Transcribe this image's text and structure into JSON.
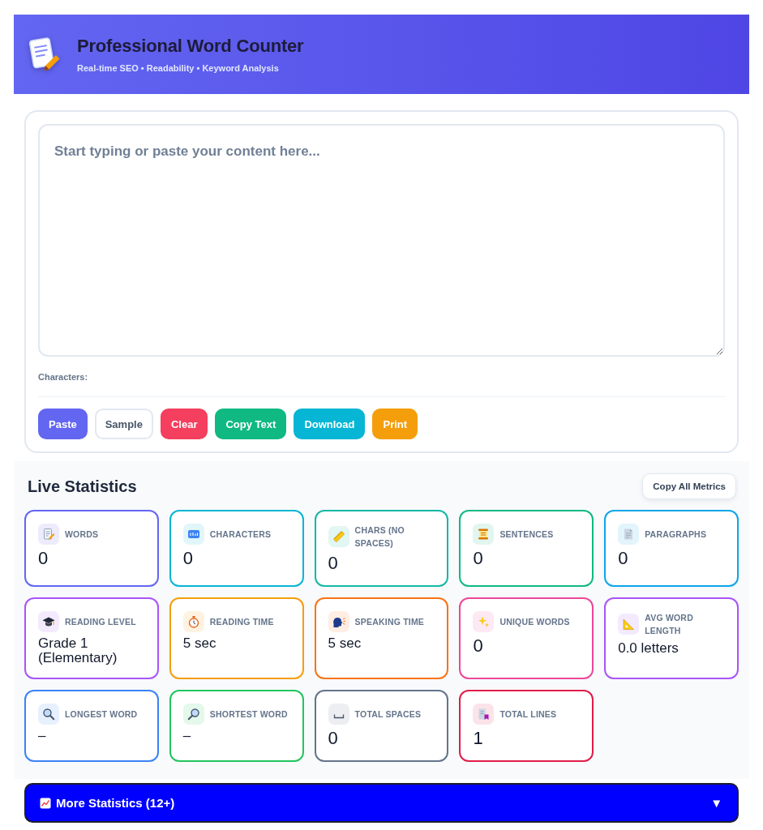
{
  "header": {
    "title": "Professional Word Counter",
    "subtitle": "Real-time SEO • Readability • Keyword Analysis"
  },
  "editor": {
    "placeholder": "Start typing or paste your content here...",
    "characters_label": "Characters:",
    "buttons": [
      {
        "label": "Paste",
        "kind": "filled",
        "color": "#6366f1"
      },
      {
        "label": "Sample",
        "kind": "outline"
      },
      {
        "label": "Clear",
        "kind": "filled",
        "color": "#f43f5e"
      },
      {
        "label": "Copy Text",
        "kind": "filled",
        "color": "#10b981"
      },
      {
        "label": "Download",
        "kind": "filled",
        "color": "#06b6d4"
      },
      {
        "label": "Print",
        "kind": "filled",
        "color": "#f59e0b"
      }
    ]
  },
  "statistics": {
    "title": "Live Statistics",
    "copy_button": "Copy All Metrics",
    "stats": [
      {
        "label": "WORDS",
        "value": "0",
        "kind": "number",
        "color": "#6366f1"
      },
      {
        "label": "CHARACTERS",
        "value": "0",
        "kind": "number",
        "color": "#06b6d4"
      },
      {
        "label": "CHARS (NO SPACES)",
        "value": "0",
        "kind": "number",
        "color": "#14b8a6"
      },
      {
        "label": "SENTENCES",
        "value": "0",
        "kind": "number",
        "color": "#10b981"
      },
      {
        "label": "PARAGRAPHS",
        "value": "0",
        "kind": "number",
        "color": "#0ea5e9"
      },
      {
        "label": "READING LEVEL",
        "value": "Grade 1 (Elementary)",
        "kind": "text",
        "color": "#a855f7"
      },
      {
        "label": "READING TIME",
        "value": "5 sec",
        "kind": "text",
        "color": "#f59e0b"
      },
      {
        "label": "SPEAKING TIME",
        "value": "5 sec",
        "kind": "text",
        "color": "#f97316"
      },
      {
        "label": "UNIQUE WORDS",
        "value": "0",
        "kind": "number",
        "color": "#ec4899"
      },
      {
        "label": "AVG WORD LENGTH",
        "value": "0.0 letters",
        "kind": "text",
        "color": "#a855f7"
      },
      {
        "label": "LONGEST WORD",
        "value": "–",
        "kind": "text",
        "color": "#3b82f6"
      },
      {
        "label": "SHORTEST WORD",
        "value": "–",
        "kind": "text",
        "color": "#22c55e"
      },
      {
        "label": "TOTAL SPACES",
        "value": "0",
        "kind": "number",
        "color": "#64748b"
      },
      {
        "label": "TOTAL LINES",
        "value": "1",
        "kind": "number",
        "color": "#e11d48"
      }
    ]
  },
  "more_statistics": {
    "label": "More Statistics (12+)",
    "toggle": "▼"
  }
}
